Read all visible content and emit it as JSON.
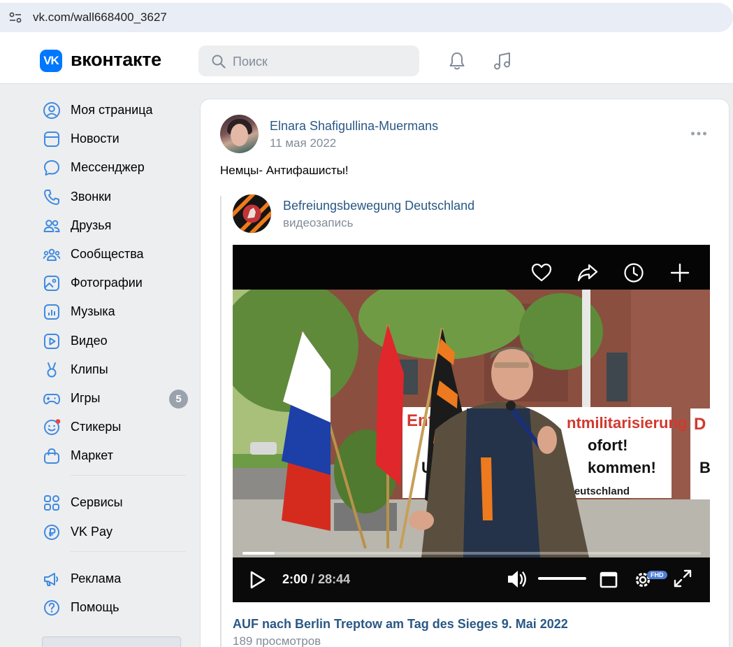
{
  "browser": {
    "url": "vk.com/wall668400_3627"
  },
  "header": {
    "logo_mark": "VK",
    "logo_text": "вконтакте",
    "search_placeholder": "Поиск"
  },
  "sidebar": {
    "items": [
      {
        "label": "Моя страница",
        "icon": "user-circle-icon"
      },
      {
        "label": "Новости",
        "icon": "news-icon"
      },
      {
        "label": "Мессенджер",
        "icon": "message-icon"
      },
      {
        "label": "Звонки",
        "icon": "phone-icon"
      },
      {
        "label": "Друзья",
        "icon": "friends-icon"
      },
      {
        "label": "Сообщества",
        "icon": "communities-icon"
      },
      {
        "label": "Фотографии",
        "icon": "photo-icon"
      },
      {
        "label": "Музыка",
        "icon": "music-icon"
      },
      {
        "label": "Видео",
        "icon": "video-icon"
      },
      {
        "label": "Клипы",
        "icon": "clips-icon"
      },
      {
        "label": "Игры",
        "icon": "gamepad-icon",
        "badge": "5"
      },
      {
        "label": "Стикеры",
        "icon": "sticker-icon"
      },
      {
        "label": "Маркет",
        "icon": "market-icon"
      }
    ],
    "items2": [
      {
        "label": "Сервисы",
        "icon": "services-icon"
      },
      {
        "label": "VK Pay",
        "icon": "vkpay-icon"
      }
    ],
    "items3": [
      {
        "label": "Реклама",
        "icon": "megaphone-icon"
      },
      {
        "label": "Помощь",
        "icon": "help-icon"
      }
    ]
  },
  "post": {
    "author": "Elnara Shafigullina-Muermans",
    "date": "11 мая 2022",
    "text": "Немцы- Антифашисты!",
    "repost": {
      "author": "Befreiungsbewegung Deutschland",
      "subtitle": "видеозапись"
    },
    "video": {
      "current_time": "2:00",
      "separator": "/",
      "total_time": "28:44",
      "progress_fraction": 0.0696,
      "quality_badge": "FHD",
      "scene_banner_text": [
        "Entm",
        "ntmilitarisierung",
        "ofort!",
        "Ur",
        "kommen!",
        "Deutschland",
        "D",
        "B"
      ],
      "title": "AUF nach Berlin Treptow am Tag des Sieges 9. Mai 2022",
      "views": "189 просмотров"
    }
  },
  "colors": {
    "brand": "#0077ff",
    "link": "#2a5885",
    "muted": "#818c99",
    "badge": "#99a2ad"
  }
}
